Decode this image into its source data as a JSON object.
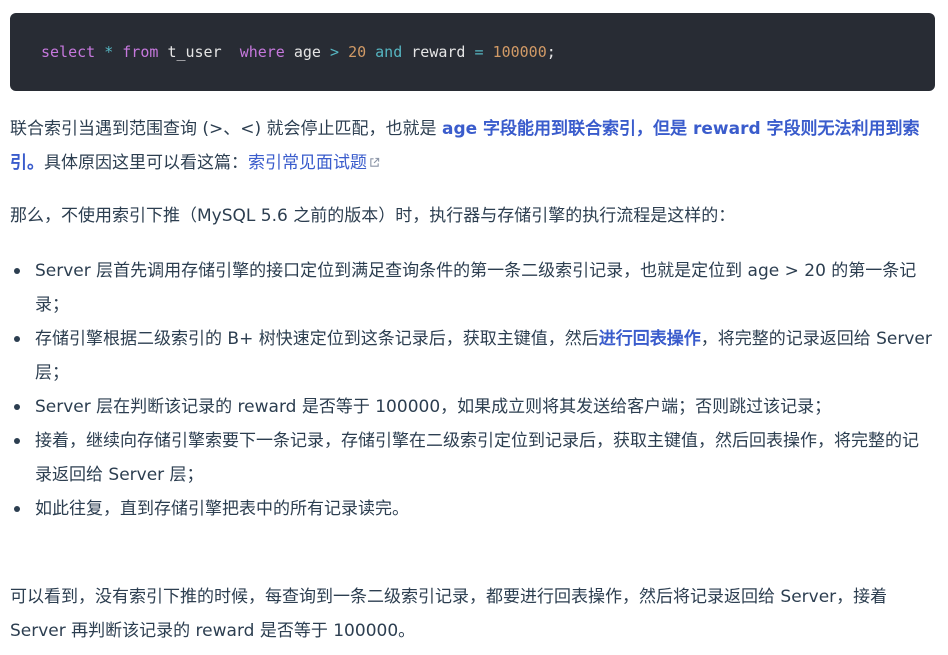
{
  "code": {
    "t1": "select",
    "t2": "*",
    "t3": "from",
    "t4": "t_user",
    "t5": "where",
    "t6": "age",
    "t7": ">",
    "t8": "20",
    "t9": "and",
    "t10": "reward",
    "t11": "=",
    "t12": "100000",
    "t13": ";"
  },
  "p1": {
    "text1": "联合索引当遇到范围查询 (>、<) 就会停止匹配，也就是 ",
    "bold1": "age 字段能用到联合索引，但是 reward 字段则无法利用到索引。",
    "text2": "具体原因这里可以看这篇：",
    "link": "索引常见面试题"
  },
  "p2": {
    "text": "那么，不使用索引下推（MySQL 5.6 之前的版本）时，执行器与存储引擎的执行流程是这样的："
  },
  "bullets": [
    {
      "text": "Server 层首先调用存储引擎的接口定位到满足查询条件的第一条二级索引记录，也就是定位到 age > 20 的第一条记录；"
    },
    {
      "text1": "存储引擎根据二级索引的 B+ 树快速定位到这条记录后，获取主键值，然后",
      "bold": "进行回表操作",
      "text2": "，将完整的记录返回给 Server 层；"
    },
    {
      "text": "Server 层在判断该记录的 reward 是否等于 100000，如果成立则将其发送给客户端；否则跳过该记录；"
    },
    {
      "text": "接着，继续向存储引擎索要下一条记录，存储引擎在二级索引定位到记录后，获取主键值，然后回表操作，将完整的记录返回给 Server 层；"
    },
    {
      "text": "如此往复，直到存储引擎把表中的所有记录读完。"
    }
  ],
  "p3": {
    "text": "可以看到，没有索引下推的时候，每查询到一条二级索引记录，都要进行回表操作，然后将记录返回给 Server，接着 Server 再判断该记录的 reward 是否等于 100000。"
  },
  "colors": {
    "code_bg": "#282c34",
    "keyword": "#c678dd",
    "operator": "#56b6c2",
    "number": "#d19a66",
    "emphasis": "#3a5ccc",
    "body_text": "#2c3e50"
  }
}
